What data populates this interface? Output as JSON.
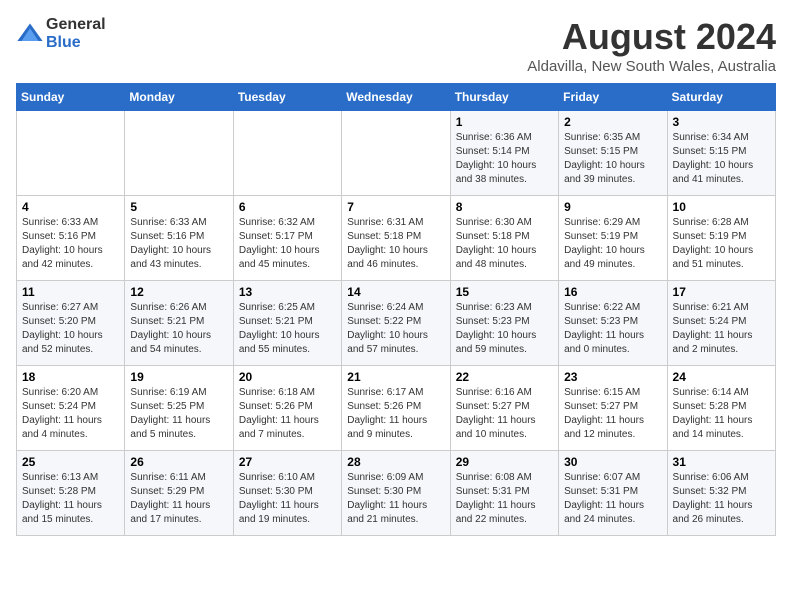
{
  "logo": {
    "general": "General",
    "blue": "Blue"
  },
  "title": "August 2024",
  "subtitle": "Aldavilla, New South Wales, Australia",
  "days_of_week": [
    "Sunday",
    "Monday",
    "Tuesday",
    "Wednesday",
    "Thursday",
    "Friday",
    "Saturday"
  ],
  "weeks": [
    [
      {
        "day": "",
        "info": ""
      },
      {
        "day": "",
        "info": ""
      },
      {
        "day": "",
        "info": ""
      },
      {
        "day": "",
        "info": ""
      },
      {
        "day": "1",
        "info": "Sunrise: 6:36 AM\nSunset: 5:14 PM\nDaylight: 10 hours\nand 38 minutes."
      },
      {
        "day": "2",
        "info": "Sunrise: 6:35 AM\nSunset: 5:15 PM\nDaylight: 10 hours\nand 39 minutes."
      },
      {
        "day": "3",
        "info": "Sunrise: 6:34 AM\nSunset: 5:15 PM\nDaylight: 10 hours\nand 41 minutes."
      }
    ],
    [
      {
        "day": "4",
        "info": "Sunrise: 6:33 AM\nSunset: 5:16 PM\nDaylight: 10 hours\nand 42 minutes."
      },
      {
        "day": "5",
        "info": "Sunrise: 6:33 AM\nSunset: 5:16 PM\nDaylight: 10 hours\nand 43 minutes."
      },
      {
        "day": "6",
        "info": "Sunrise: 6:32 AM\nSunset: 5:17 PM\nDaylight: 10 hours\nand 45 minutes."
      },
      {
        "day": "7",
        "info": "Sunrise: 6:31 AM\nSunset: 5:18 PM\nDaylight: 10 hours\nand 46 minutes."
      },
      {
        "day": "8",
        "info": "Sunrise: 6:30 AM\nSunset: 5:18 PM\nDaylight: 10 hours\nand 48 minutes."
      },
      {
        "day": "9",
        "info": "Sunrise: 6:29 AM\nSunset: 5:19 PM\nDaylight: 10 hours\nand 49 minutes."
      },
      {
        "day": "10",
        "info": "Sunrise: 6:28 AM\nSunset: 5:19 PM\nDaylight: 10 hours\nand 51 minutes."
      }
    ],
    [
      {
        "day": "11",
        "info": "Sunrise: 6:27 AM\nSunset: 5:20 PM\nDaylight: 10 hours\nand 52 minutes."
      },
      {
        "day": "12",
        "info": "Sunrise: 6:26 AM\nSunset: 5:21 PM\nDaylight: 10 hours\nand 54 minutes."
      },
      {
        "day": "13",
        "info": "Sunrise: 6:25 AM\nSunset: 5:21 PM\nDaylight: 10 hours\nand 55 minutes."
      },
      {
        "day": "14",
        "info": "Sunrise: 6:24 AM\nSunset: 5:22 PM\nDaylight: 10 hours\nand 57 minutes."
      },
      {
        "day": "15",
        "info": "Sunrise: 6:23 AM\nSunset: 5:23 PM\nDaylight: 10 hours\nand 59 minutes."
      },
      {
        "day": "16",
        "info": "Sunrise: 6:22 AM\nSunset: 5:23 PM\nDaylight: 11 hours\nand 0 minutes."
      },
      {
        "day": "17",
        "info": "Sunrise: 6:21 AM\nSunset: 5:24 PM\nDaylight: 11 hours\nand 2 minutes."
      }
    ],
    [
      {
        "day": "18",
        "info": "Sunrise: 6:20 AM\nSunset: 5:24 PM\nDaylight: 11 hours\nand 4 minutes."
      },
      {
        "day": "19",
        "info": "Sunrise: 6:19 AM\nSunset: 5:25 PM\nDaylight: 11 hours\nand 5 minutes."
      },
      {
        "day": "20",
        "info": "Sunrise: 6:18 AM\nSunset: 5:26 PM\nDaylight: 11 hours\nand 7 minutes."
      },
      {
        "day": "21",
        "info": "Sunrise: 6:17 AM\nSunset: 5:26 PM\nDaylight: 11 hours\nand 9 minutes."
      },
      {
        "day": "22",
        "info": "Sunrise: 6:16 AM\nSunset: 5:27 PM\nDaylight: 11 hours\nand 10 minutes."
      },
      {
        "day": "23",
        "info": "Sunrise: 6:15 AM\nSunset: 5:27 PM\nDaylight: 11 hours\nand 12 minutes."
      },
      {
        "day": "24",
        "info": "Sunrise: 6:14 AM\nSunset: 5:28 PM\nDaylight: 11 hours\nand 14 minutes."
      }
    ],
    [
      {
        "day": "25",
        "info": "Sunrise: 6:13 AM\nSunset: 5:28 PM\nDaylight: 11 hours\nand 15 minutes."
      },
      {
        "day": "26",
        "info": "Sunrise: 6:11 AM\nSunset: 5:29 PM\nDaylight: 11 hours\nand 17 minutes."
      },
      {
        "day": "27",
        "info": "Sunrise: 6:10 AM\nSunset: 5:30 PM\nDaylight: 11 hours\nand 19 minutes."
      },
      {
        "day": "28",
        "info": "Sunrise: 6:09 AM\nSunset: 5:30 PM\nDaylight: 11 hours\nand 21 minutes."
      },
      {
        "day": "29",
        "info": "Sunrise: 6:08 AM\nSunset: 5:31 PM\nDaylight: 11 hours\nand 22 minutes."
      },
      {
        "day": "30",
        "info": "Sunrise: 6:07 AM\nSunset: 5:31 PM\nDaylight: 11 hours\nand 24 minutes."
      },
      {
        "day": "31",
        "info": "Sunrise: 6:06 AM\nSunset: 5:32 PM\nDaylight: 11 hours\nand 26 minutes."
      }
    ]
  ]
}
